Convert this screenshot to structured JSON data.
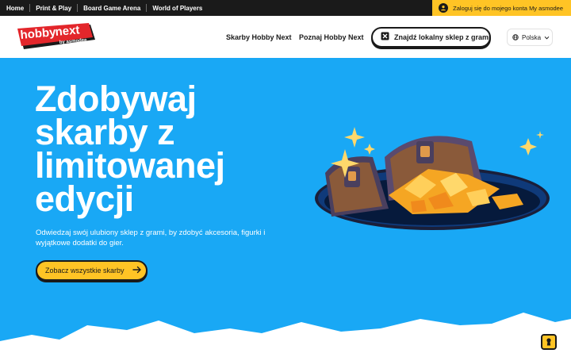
{
  "topbar": {
    "links": [
      "Home",
      "Print & Play",
      "Board Game Arena",
      "World of Players"
    ],
    "login_label": "Zaloguj się do mojego konta My asmodee",
    "login_icon": "user-icon"
  },
  "header": {
    "logo": {
      "name": "hobby next logo",
      "wordmark": "hobbynext",
      "tagline": "by asmodee"
    },
    "nav": [
      "Skarby Hobby Next",
      "Poznaj Hobby Next"
    ],
    "store_button_label": "Znajdź lokalny sklep z grami",
    "store_button_icon": "map-icon",
    "country_label": "Polska",
    "country_icon": "globe-icon"
  },
  "hero": {
    "title": "Zdobywaj skarby z limitowanej edycji",
    "subtitle": "Odwiedzaj swój ulubiony sklep z grami, by zdobyć akcesoria, figurki i wyjątkowe dodatki do gier.",
    "cta_label": "Zobacz wszystkie skarby",
    "cta_icon": "arrow-right-icon",
    "illustration": "treasure-chests-illustration",
    "keyhole_icon": "keyhole-icon"
  },
  "colors": {
    "hero_bg": "#19a8f5",
    "accent_yellow": "#ffc425",
    "dark": "#1a1a1a",
    "logo_red": "#e3262b"
  }
}
